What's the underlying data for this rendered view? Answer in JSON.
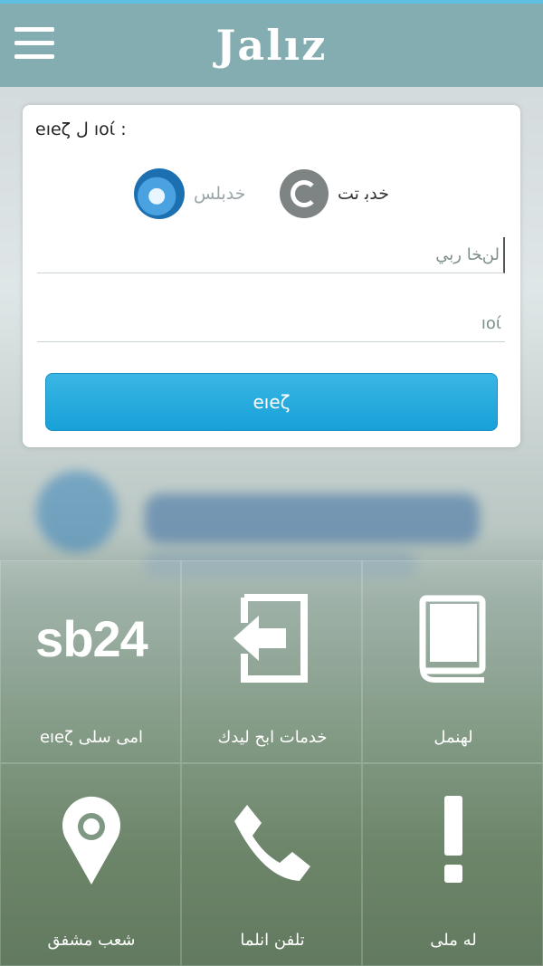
{
  "header": {
    "logo_text": "Jalız"
  },
  "login": {
    "title": "eıeζ ل ıoί :",
    "options": [
      {
        "label": "ﺧﺪﺑ ﺗﺖ",
        "icon": "swirl-logo-icon"
      },
      {
        "label": "ﺧﺪﺑﻠﺲ",
        "icon": "globe-logo-icon"
      }
    ],
    "username_placeholder": "ﻟﻦﺨﺎ ﺭﺑﻲ",
    "password_placeholder": "ıoί",
    "submit_label": "eıeζ"
  },
  "tiles": [
    {
      "label": "eıeζ ﺍﻣﻰ ﺳﻠﻰ",
      "icon": "sb24-text-icon",
      "icon_text": "sb24"
    },
    {
      "label": "ﺧﺪﻣﺎﺕ ﺍﺑﺢ ﻟﻴﺪﻙ",
      "icon": "login-arrow-icon"
    },
    {
      "label": "ﻟﻬﻨﻤﻞ",
      "icon": "book-icon"
    },
    {
      "label": "ﺷﻌﺐ ﻣﺸﻔﻖ",
      "icon": "location-pin-icon"
    },
    {
      "label": "ﺗﻠﻔﻦ ﺍﻧﻠﻤﺎ",
      "icon": "phone-icon"
    },
    {
      "label": "ﻟﻪ ﻣﻠﻰ",
      "icon": "exclamation-icon"
    }
  ]
}
